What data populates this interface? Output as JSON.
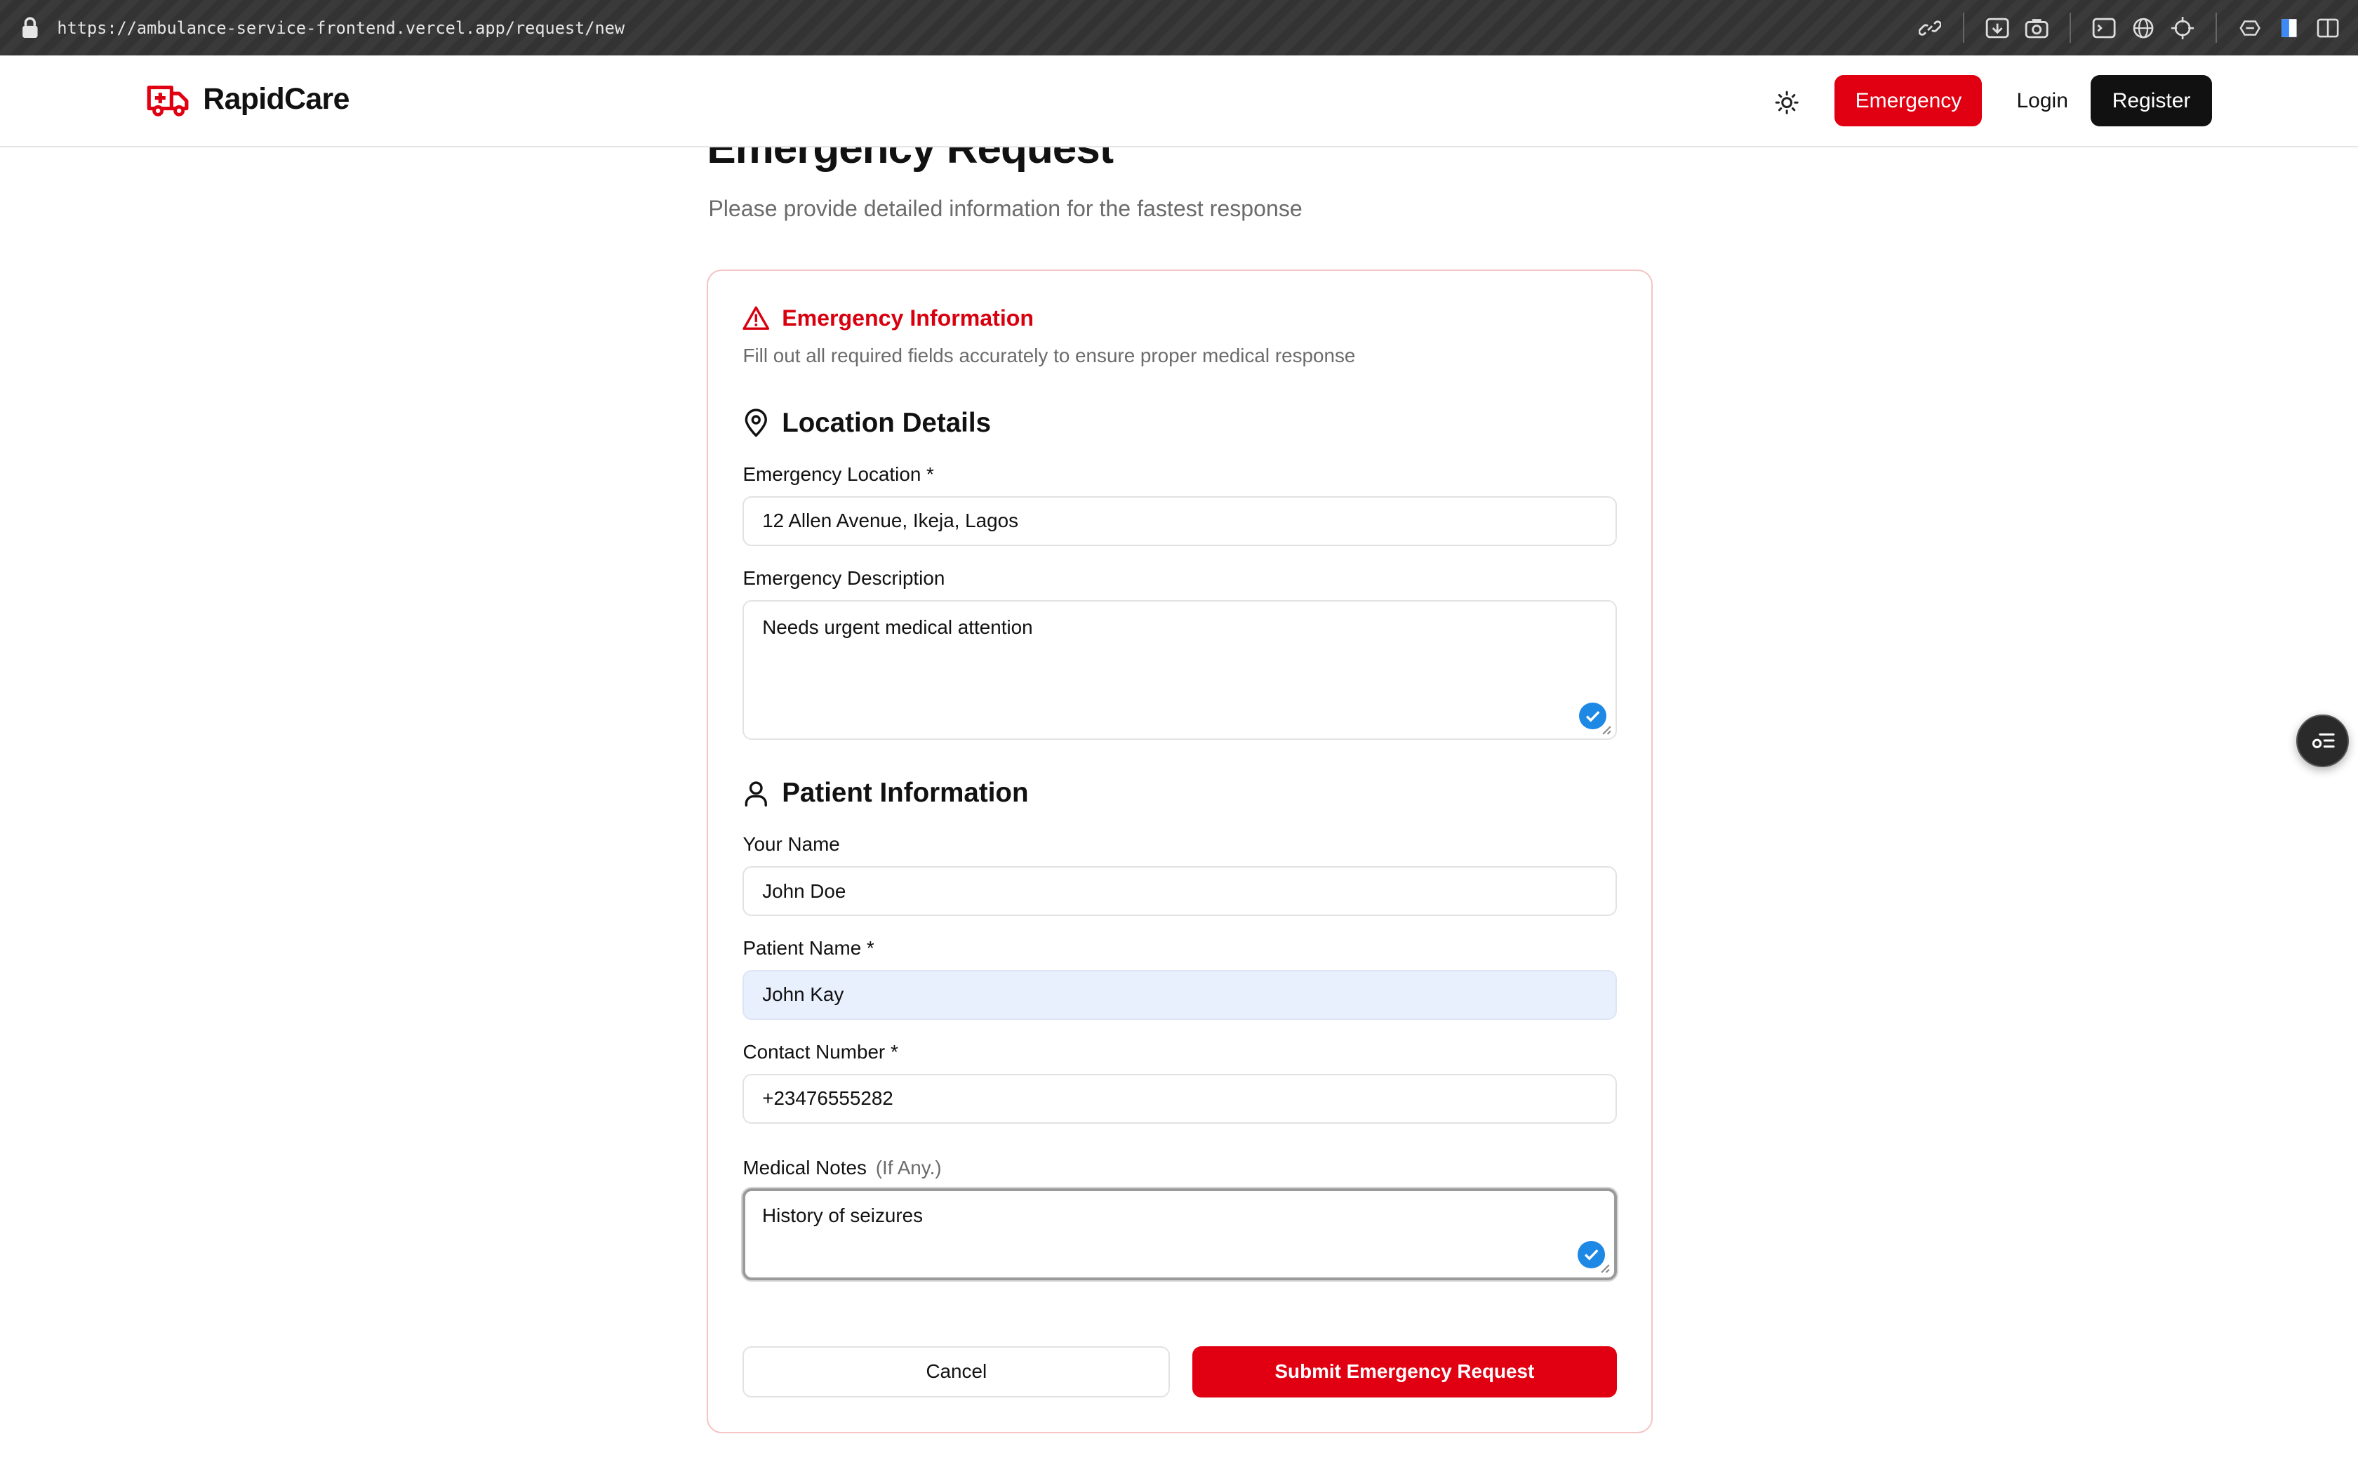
{
  "browser": {
    "url": "https://ambulance-service-frontend.vercel.app/request/new",
    "tool_icons": [
      "link-icon",
      "screen-capture-icon",
      "camera-icon",
      "terminal-icon",
      "globe-icon",
      "crosshair-icon",
      "extensions-icon",
      "bookmark-icon",
      "sidebar-icon"
    ]
  },
  "navbar": {
    "brand": "RapidCare",
    "emergency_label": "Emergency",
    "login_label": "Login",
    "register_label": "Register"
  },
  "page": {
    "title": "Emergency Request",
    "subtitle": "Please provide detailed information for the fastest response"
  },
  "card": {
    "title": "Emergency Information",
    "description": "Fill out all required fields accurately to ensure proper medical response"
  },
  "location_section": {
    "title": "Location Details",
    "location_label": "Emergency Location *",
    "location_value": "12 Allen Avenue, Ikeja, Lagos",
    "description_label": "Emergency Description",
    "description_value": "Needs urgent medical attention"
  },
  "patient_section": {
    "title": "Patient Information",
    "your_name_label": "Your Name",
    "your_name_value": "John Doe",
    "patient_name_label": "Patient Name *",
    "patient_name_value": "John Kay",
    "contact_label": "Contact Number *",
    "contact_value": "+23476555282",
    "notes_label": "Medical Notes",
    "notes_hint": "(If Any.)",
    "notes_value": "History of seizures"
  },
  "actions": {
    "cancel_label": "Cancel",
    "submit_label": "Submit Emergency Request"
  },
  "colors": {
    "brand_red": "#e00012",
    "dark": "#111111",
    "autofill_blue": "#e8f0fe",
    "check_blue": "#1e88e5"
  }
}
